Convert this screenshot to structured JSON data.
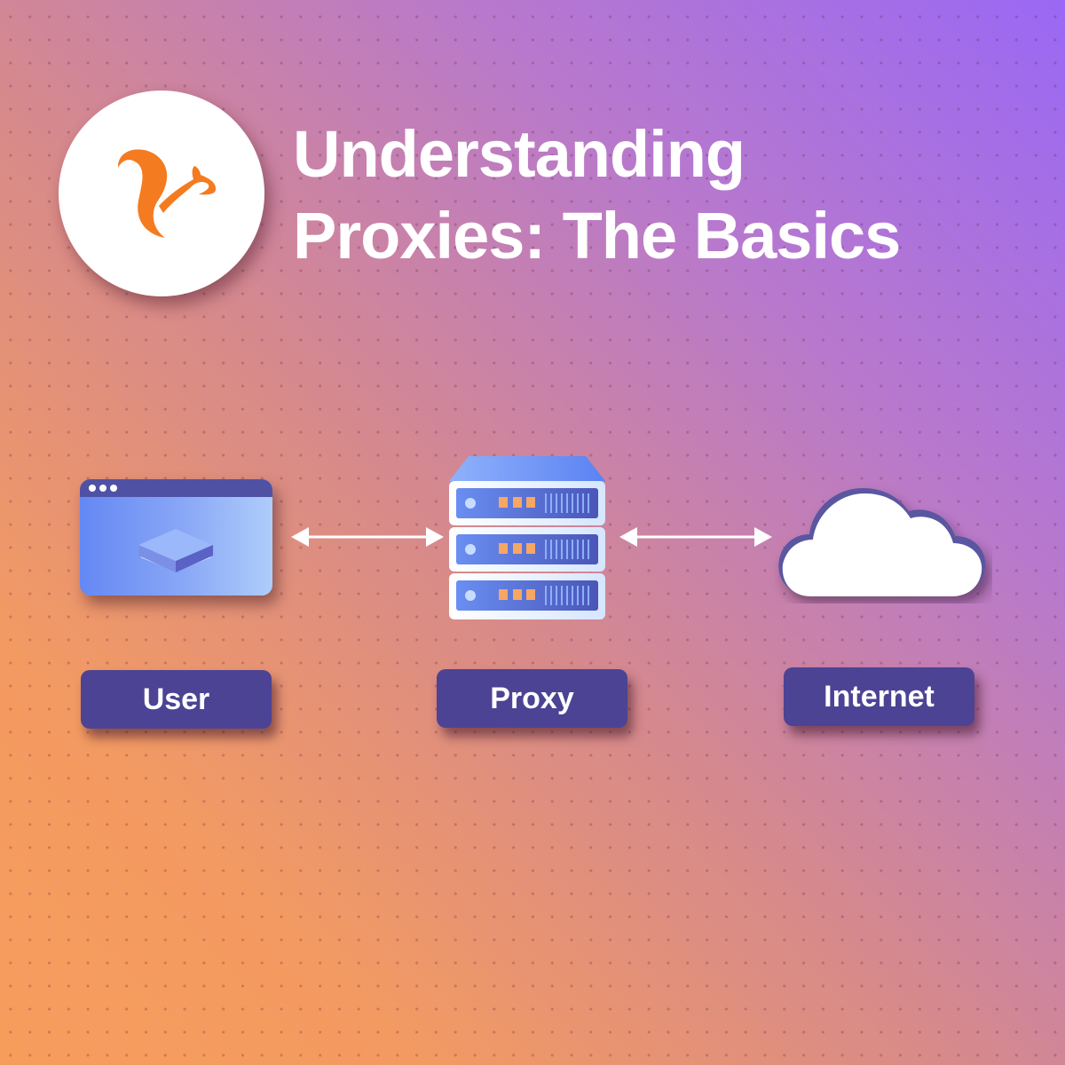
{
  "title": {
    "line1": "Understanding",
    "line2": "Proxies: The Basics"
  },
  "logo": {
    "icon": "squirrel-logo-icon",
    "color": "#f47b20"
  },
  "diagram": {
    "nodes": [
      {
        "id": "user",
        "label": "User",
        "icon": "browser-window-icon"
      },
      {
        "id": "proxy",
        "label": "Proxy",
        "icon": "server-stack-icon"
      },
      {
        "id": "internet",
        "label": "Internet",
        "icon": "cloud-icon"
      }
    ],
    "edges": [
      {
        "from": "user",
        "to": "proxy",
        "direction": "bidirectional"
      },
      {
        "from": "proxy",
        "to": "internet",
        "direction": "bidirectional"
      }
    ]
  },
  "colors": {
    "label_bg": "#4c4394",
    "accent_orange": "#f47b20",
    "bg_top_right": "#9a68f4",
    "bg_bottom_left": "#f79d5c"
  }
}
